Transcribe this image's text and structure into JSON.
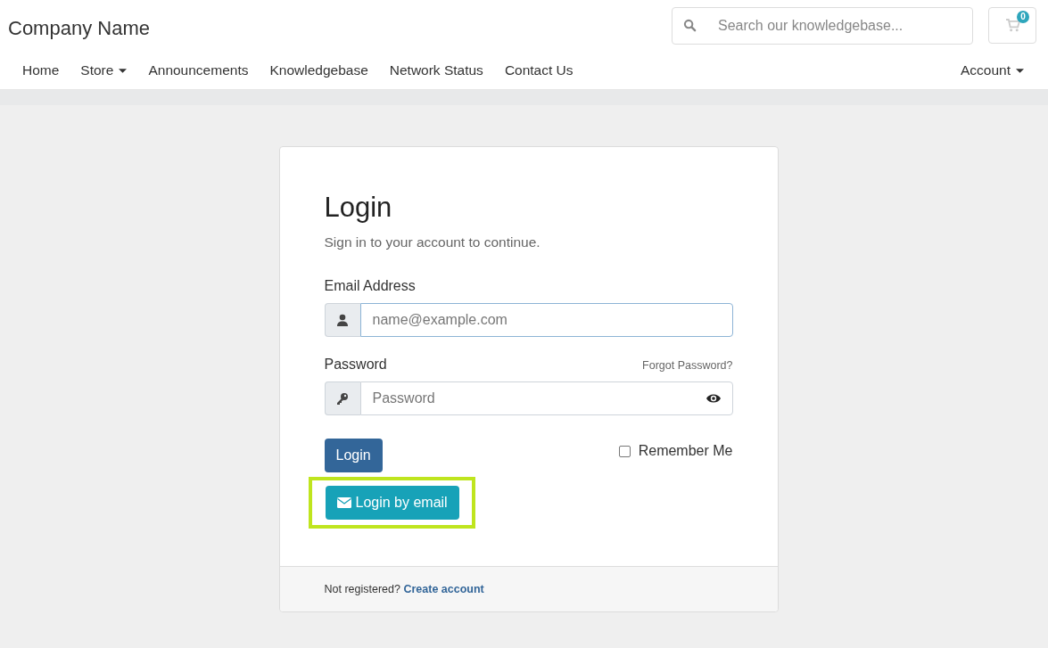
{
  "header": {
    "brand": "Company Name",
    "search": {
      "placeholder": "Search our knowledgebase..."
    },
    "cart": {
      "count": "0"
    }
  },
  "nav": {
    "items": [
      {
        "label": "Home",
        "dropdown": false
      },
      {
        "label": "Store",
        "dropdown": true
      },
      {
        "label": "Announcements",
        "dropdown": false
      },
      {
        "label": "Knowledgebase",
        "dropdown": false
      },
      {
        "label": "Network Status",
        "dropdown": false
      },
      {
        "label": "Contact Us",
        "dropdown": false
      }
    ],
    "right": [
      {
        "label": "Account",
        "dropdown": true
      }
    ]
  },
  "login": {
    "title": "Login",
    "subtitle": "Sign in to your account to continue.",
    "email": {
      "label": "Email Address",
      "placeholder": "name@example.com"
    },
    "password": {
      "label": "Password",
      "forgot": "Forgot Password?",
      "placeholder": "Password"
    },
    "submit": "Login",
    "remember": {
      "label": "Remember Me",
      "checked": false
    },
    "email_login": {
      "label": "Login by email",
      "highlighted": true
    },
    "footer": {
      "text": "Not registered?",
      "link": "Create account"
    }
  }
}
